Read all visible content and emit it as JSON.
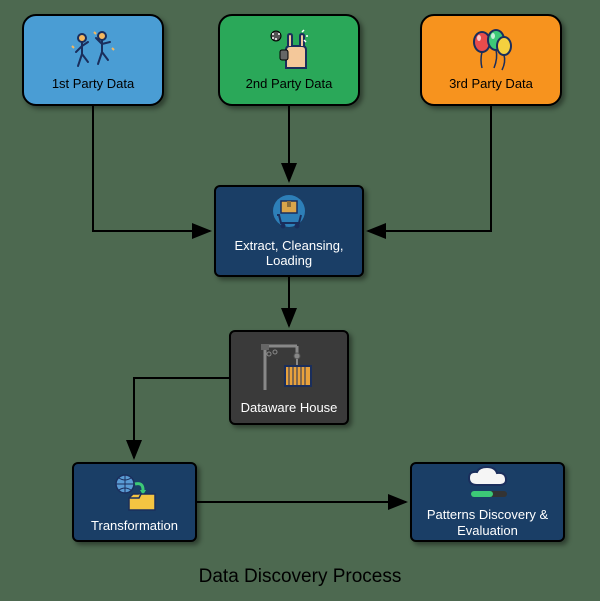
{
  "diagram": {
    "title": "Data Discovery Process",
    "nodes": {
      "firstParty": {
        "label": "1st Party Data",
        "icon": "dancers-icon"
      },
      "secondParty": {
        "label": "2nd Party Data",
        "icon": "rock-hand-icon"
      },
      "thirdParty": {
        "label": "3rd Party Data",
        "icon": "balloons-icon"
      },
      "extract": {
        "label": "Extract, Cleansing, Loading",
        "icon": "cart-box-icon"
      },
      "dataware": {
        "label": "Dataware House",
        "icon": "crane-container-icon"
      },
      "transformation": {
        "label": "Transformation",
        "icon": "globe-folder-icon"
      },
      "patterns": {
        "label": "Patterns Discovery & Evaluation",
        "icon": "cloud-bar-icon"
      }
    },
    "edges": [
      {
        "from": "firstParty",
        "to": "extract"
      },
      {
        "from": "secondParty",
        "to": "extract"
      },
      {
        "from": "thirdParty",
        "to": "extract"
      },
      {
        "from": "extract",
        "to": "dataware"
      },
      {
        "from": "dataware",
        "to": "transformation"
      },
      {
        "from": "transformation",
        "to": "patterns"
      }
    ],
    "colors": {
      "firstParty": "#4a9dd4",
      "secondParty": "#2aa859",
      "thirdParty": "#f7931e",
      "darkBlue": "#1a3e66",
      "darkGray": "#3a3a3a",
      "background": "#4d6950"
    }
  }
}
